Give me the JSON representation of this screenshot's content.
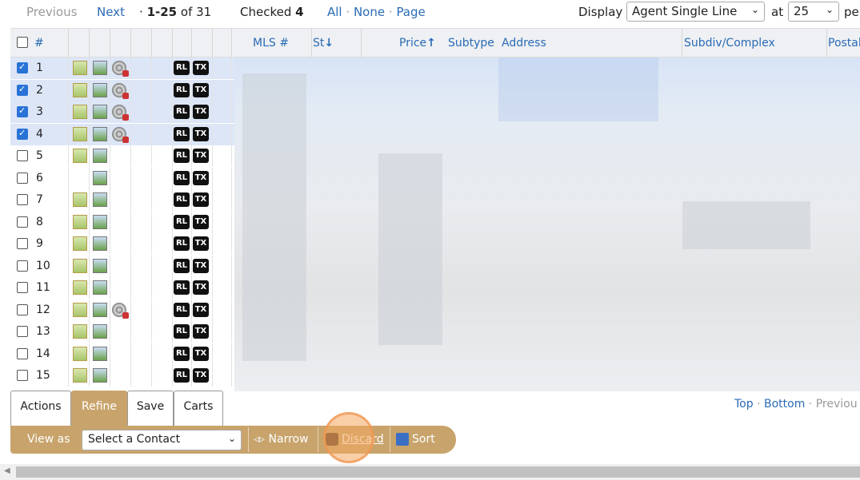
{
  "topbar": {
    "previous": "Previous",
    "next": "Next",
    "range_prefix": "·",
    "range": "1-25",
    "range_of": "of",
    "total": "31",
    "checked_label": "Checked",
    "checked_count": "4",
    "all": "All",
    "none": "None",
    "page": "Page",
    "dot": "·",
    "display_label": "Display",
    "display_value": "Agent Single Line",
    "at_label": "at",
    "per_value": "25",
    "per_label": "pe"
  },
  "header": {
    "num": "#",
    "mls": "MLS #",
    "st": "St",
    "price": "Price",
    "subtype": "Subtype",
    "address": "Address",
    "subdiv": "Subdiv/Complex",
    "postal": "Postal"
  },
  "rows": [
    {
      "num": "1",
      "checked": true,
      "photo": true,
      "video": true
    },
    {
      "num": "2",
      "checked": true,
      "photo": true,
      "video": true
    },
    {
      "num": "3",
      "checked": true,
      "photo": true,
      "video": true
    },
    {
      "num": "4",
      "checked": true,
      "photo": true,
      "video": true
    },
    {
      "num": "5",
      "checked": false,
      "photo": true,
      "video": false
    },
    {
      "num": "6",
      "checked": false,
      "photo": false,
      "video": false
    },
    {
      "num": "7",
      "checked": false,
      "photo": true,
      "video": false
    },
    {
      "num": "8",
      "checked": false,
      "photo": true,
      "video": false
    },
    {
      "num": "9",
      "checked": false,
      "photo": true,
      "video": false
    },
    {
      "num": "10",
      "checked": false,
      "photo": true,
      "video": false
    },
    {
      "num": "11",
      "checked": false,
      "photo": true,
      "video": false
    },
    {
      "num": "12",
      "checked": false,
      "photo": true,
      "video": true
    },
    {
      "num": "13",
      "checked": false,
      "photo": true,
      "video": false
    },
    {
      "num": "14",
      "checked": false,
      "photo": true,
      "video": false
    },
    {
      "num": "15",
      "checked": false,
      "photo": true,
      "video": false
    }
  ],
  "tags": {
    "rl": "RL",
    "tx": "TX"
  },
  "tabs": {
    "actions": "Actions",
    "refine": "Refine",
    "save": "Save",
    "carts": "Carts"
  },
  "toolbar": {
    "view_as": "View as",
    "contact_value": "Select a Contact",
    "narrow": "Narrow",
    "discard": "Discard",
    "sort": "Sort"
  },
  "bottom": {
    "top": "Top",
    "bottom": "Bottom",
    "previous": "Previou",
    "dot": "·"
  },
  "colors": {
    "accent": "#c8a46c",
    "link": "#2a6bb5",
    "selected_row": "#dce6f7",
    "highlight": "#f4a860"
  },
  "icons": [
    "photo-icon",
    "photo-alt-icon",
    "film-reel-icon",
    "sort-desc-icon",
    "sort-asc-icon",
    "narrow-icon",
    "discard-icon",
    "sort-az-icon",
    "chevron-down-icon"
  ]
}
